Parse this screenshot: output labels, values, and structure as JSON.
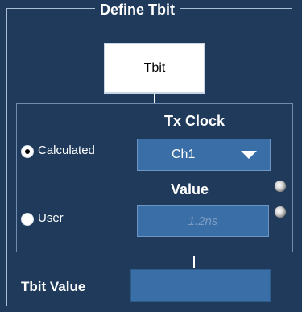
{
  "group": {
    "title": "Define Tbit"
  },
  "diagram": {
    "tbit_label": "Tbit"
  },
  "tx_clock": {
    "title": "Tx Clock",
    "calculated_label": "Calculated",
    "user_label": "User",
    "selected_option": "Calculated",
    "source_value": "Ch1"
  },
  "value_section": {
    "title": "Value",
    "value_placeholder": "1.2ns"
  },
  "footer": {
    "tbit_value_label": "Tbit Value",
    "tbit_value": ""
  },
  "icons": {
    "dropdown_caret": "chevron-down-icon",
    "knob": "knob-icon"
  },
  "colors": {
    "background": "#1f3a5b",
    "field": "#3a6ea6",
    "text": "#ffffff"
  }
}
